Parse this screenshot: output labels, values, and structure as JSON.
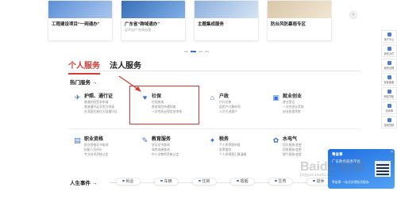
{
  "carousel": {
    "cards": [
      {
        "title": "工程建设项目“一网通办”",
        "subtitle": "..."
      },
      {
        "title": "广东省“跨域通办”",
        "subtitle": "足不出户 在线办理 ..."
      },
      {
        "title": "主题集成服务",
        "subtitle": "..."
      },
      {
        "title": "防台风防暴雨专区",
        "subtitle": "..."
      }
    ],
    "next_icon": "›"
  },
  "tabs": [
    {
      "label": "个人服务"
    },
    {
      "label": "法人服务"
    }
  ],
  "hot_services": {
    "title": "热门服务 →",
    "items": [
      {
        "name": "护照、通行证",
        "icon": "✈",
        "lines": [
          "普通护照签发申请",
          "港澳通行证及签注申请",
          "台湾居民来往大陆通行证"
        ]
      },
      {
        "name": "社保",
        "icon": "♥",
        "lines": [
          "社保查询",
          "养老保险待遇领取",
          "一次性失业保险金申领"
        ]
      },
      {
        "name": "户政",
        "icon": "⌂",
        "lines": [
          "户口迁移",
          "居民户口簿补领",
          "人才引进落户"
        ]
      },
      {
        "name": "就业创业",
        "icon": "▣",
        "lines": [
          "就业登记",
          "一次性创业资助",
          "创业担保贷款"
        ]
      },
      {
        "name": "职业资格",
        "icon": "▤",
        "lines": [
          "职业资格证书查询",
          "技能人员评价",
          "专业技术资格认定"
        ]
      },
      {
        "name": "教育服务",
        "icon": "✎",
        "lines": [
          "学历证书查询",
          "高考成绩查询",
          "中小学教师资格认定"
        ]
      },
      {
        "name": "税务",
        "icon": "✦",
        "lines": [
          "个人所得税申报",
          "发票查验",
          "个人所得税汇算清缴"
        ]
      },
      {
        "name": "水电气",
        "icon": "✿",
        "lines": [
          "用水报装/变更",
          "用电报装/变更",
          "燃气报装/变更"
        ]
      }
    ]
  },
  "life_events": {
    "title": "人生事件 →",
    "items": [
      "就业",
      "车辆",
      "住房",
      "婚姻",
      "生育",
      "退休"
    ]
  },
  "sidebar": {
    "items": [
      "用户中心",
      "我的办件",
      "我的证照",
      "智能客服",
      "网站导航",
      "无障碍",
      "返回顶部"
    ]
  },
  "promo": {
    "brand": "粤省事",
    "line1": "广东政务服务平台",
    "line2": "粤省事 一站式办理各类服务",
    "close": "×"
  },
  "watermark": {
    "text": "Baidu 经验",
    "sub": "jingyan.baidu.com"
  }
}
